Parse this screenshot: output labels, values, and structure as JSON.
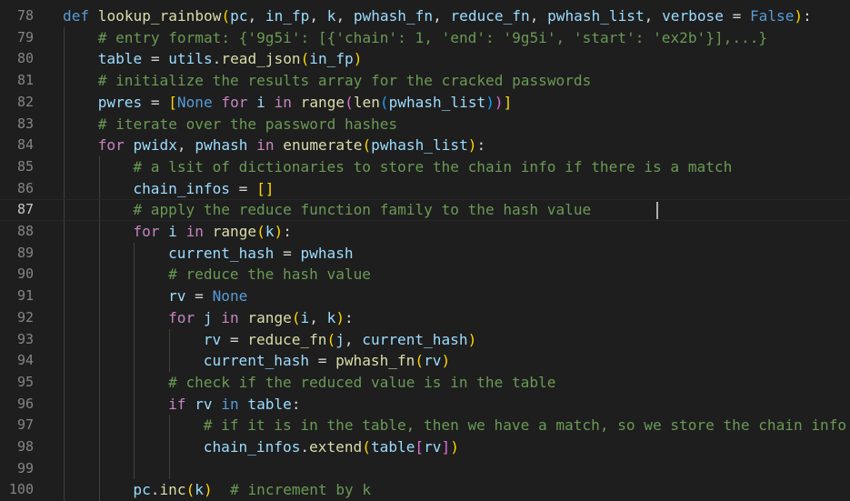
{
  "editor": {
    "cursor_line": 87,
    "lines": [
      {
        "n": "78",
        "ind": 0,
        "t": [
          [
            "kw",
            "def"
          ],
          [
            "pn",
            " "
          ],
          [
            "fn",
            "lookup_rainbow"
          ],
          [
            "br1",
            "("
          ],
          [
            "var",
            "pc"
          ],
          [
            "pn",
            ", "
          ],
          [
            "var",
            "in_fp"
          ],
          [
            "pn",
            ", "
          ],
          [
            "var",
            "k"
          ],
          [
            "pn",
            ", "
          ],
          [
            "var",
            "pwhash_fn"
          ],
          [
            "pn",
            ", "
          ],
          [
            "var",
            "reduce_fn"
          ],
          [
            "pn",
            ", "
          ],
          [
            "var",
            "pwhash_list"
          ],
          [
            "pn",
            ", "
          ],
          [
            "var",
            "verbose"
          ],
          [
            "pn",
            " = "
          ],
          [
            "kw",
            "False"
          ],
          [
            "br1",
            ")"
          ],
          [
            "pn",
            ":"
          ]
        ]
      },
      {
        "n": "79",
        "ind": 1,
        "t": [
          [
            "cm",
            "# entry format: {'9g5i': [{'chain': 1, 'end': '9g5i', 'start': 'ex2b'}],...}"
          ]
        ]
      },
      {
        "n": "80",
        "ind": 1,
        "t": [
          [
            "var",
            "table"
          ],
          [
            "pn",
            " = "
          ],
          [
            "var",
            "utils"
          ],
          [
            "pn",
            "."
          ],
          [
            "fn",
            "read_json"
          ],
          [
            "br1",
            "("
          ],
          [
            "var",
            "in_fp"
          ],
          [
            "br1",
            ")"
          ]
        ]
      },
      {
        "n": "81",
        "ind": 1,
        "t": [
          [
            "cm",
            "# initialize the results array for the cracked passwords"
          ]
        ]
      },
      {
        "n": "82",
        "ind": 1,
        "t": [
          [
            "var",
            "pwres"
          ],
          [
            "pn",
            " = "
          ],
          [
            "br1",
            "["
          ],
          [
            "kw",
            "None"
          ],
          [
            "pn",
            " "
          ],
          [
            "ctl",
            "for"
          ],
          [
            "pn",
            " "
          ],
          [
            "var",
            "i"
          ],
          [
            "pn",
            " "
          ],
          [
            "ctl",
            "in"
          ],
          [
            "pn",
            " "
          ],
          [
            "fn",
            "range"
          ],
          [
            "br2",
            "("
          ],
          [
            "fn",
            "len"
          ],
          [
            "br3",
            "("
          ],
          [
            "var",
            "pwhash_list"
          ],
          [
            "br3",
            ")"
          ],
          [
            "br2",
            ")"
          ],
          [
            "br1",
            "]"
          ]
        ]
      },
      {
        "n": "83",
        "ind": 1,
        "t": [
          [
            "cm",
            "# iterate over the password hashes"
          ]
        ]
      },
      {
        "n": "84",
        "ind": 1,
        "t": [
          [
            "ctl",
            "for"
          ],
          [
            "pn",
            " "
          ],
          [
            "var",
            "pwidx"
          ],
          [
            "pn",
            ", "
          ],
          [
            "var",
            "pwhash"
          ],
          [
            "pn",
            " "
          ],
          [
            "ctl",
            "in"
          ],
          [
            "pn",
            " "
          ],
          [
            "fn",
            "enumerate"
          ],
          [
            "br1",
            "("
          ],
          [
            "var",
            "pwhash_list"
          ],
          [
            "br1",
            ")"
          ],
          [
            "pn",
            ":"
          ]
        ]
      },
      {
        "n": "85",
        "ind": 2,
        "t": [
          [
            "cm",
            "# a lsit of dictionaries to store the chain info if there is a match"
          ]
        ]
      },
      {
        "n": "86",
        "ind": 2,
        "t": [
          [
            "var",
            "chain_infos"
          ],
          [
            "pn",
            " = "
          ],
          [
            "br1",
            "[]"
          ]
        ]
      },
      {
        "n": "87",
        "ind": 2,
        "t": [
          [
            "cm",
            "# apply the reduce function family to the hash value"
          ]
        ]
      },
      {
        "n": "88",
        "ind": 2,
        "t": [
          [
            "ctl",
            "for"
          ],
          [
            "pn",
            " "
          ],
          [
            "var",
            "i"
          ],
          [
            "pn",
            " "
          ],
          [
            "ctl",
            "in"
          ],
          [
            "pn",
            " "
          ],
          [
            "fn",
            "range"
          ],
          [
            "br1",
            "("
          ],
          [
            "var",
            "k"
          ],
          [
            "br1",
            ")"
          ],
          [
            "pn",
            ":"
          ]
        ]
      },
      {
        "n": "89",
        "ind": 3,
        "t": [
          [
            "var",
            "current_hash"
          ],
          [
            "pn",
            " = "
          ],
          [
            "var",
            "pwhash"
          ]
        ]
      },
      {
        "n": "90",
        "ind": 3,
        "t": [
          [
            "cm",
            "# reduce the hash value"
          ]
        ]
      },
      {
        "n": "91",
        "ind": 3,
        "t": [
          [
            "var",
            "rv"
          ],
          [
            "pn",
            " = "
          ],
          [
            "kw",
            "None"
          ]
        ]
      },
      {
        "n": "92",
        "ind": 3,
        "t": [
          [
            "ctl",
            "for"
          ],
          [
            "pn",
            " "
          ],
          [
            "var",
            "j"
          ],
          [
            "pn",
            " "
          ],
          [
            "ctl",
            "in"
          ],
          [
            "pn",
            " "
          ],
          [
            "fn",
            "range"
          ],
          [
            "br1",
            "("
          ],
          [
            "var",
            "i"
          ],
          [
            "pn",
            ", "
          ],
          [
            "var",
            "k"
          ],
          [
            "br1",
            ")"
          ],
          [
            "pn",
            ":"
          ]
        ]
      },
      {
        "n": "93",
        "ind": 4,
        "t": [
          [
            "var",
            "rv"
          ],
          [
            "pn",
            " = "
          ],
          [
            "fn",
            "reduce_fn"
          ],
          [
            "br1",
            "("
          ],
          [
            "var",
            "j"
          ],
          [
            "pn",
            ", "
          ],
          [
            "var",
            "current_hash"
          ],
          [
            "br1",
            ")"
          ]
        ]
      },
      {
        "n": "94",
        "ind": 4,
        "t": [
          [
            "var",
            "current_hash"
          ],
          [
            "pn",
            " = "
          ],
          [
            "fn",
            "pwhash_fn"
          ],
          [
            "br1",
            "("
          ],
          [
            "var",
            "rv"
          ],
          [
            "br1",
            ")"
          ]
        ]
      },
      {
        "n": "95",
        "ind": 3,
        "t": [
          [
            "cm",
            "# check if the reduced value is in the table"
          ]
        ]
      },
      {
        "n": "96",
        "ind": 3,
        "t": [
          [
            "ctl",
            "if"
          ],
          [
            "pn",
            " "
          ],
          [
            "var",
            "rv"
          ],
          [
            "pn",
            " "
          ],
          [
            "kw",
            "in"
          ],
          [
            "pn",
            " "
          ],
          [
            "var",
            "table"
          ],
          [
            "pn",
            ":"
          ]
        ]
      },
      {
        "n": "97",
        "ind": 4,
        "t": [
          [
            "cm",
            "# if it is in the table, then we have a match, so we store the chain info"
          ]
        ]
      },
      {
        "n": "98",
        "ind": 4,
        "t": [
          [
            "var",
            "chain_infos"
          ],
          [
            "pn",
            "."
          ],
          [
            "fn",
            "extend"
          ],
          [
            "br1",
            "("
          ],
          [
            "var",
            "table"
          ],
          [
            "br2",
            "["
          ],
          [
            "var",
            "rv"
          ],
          [
            "br2",
            "]"
          ],
          [
            "br1",
            ")"
          ]
        ]
      },
      {
        "n": "99",
        "ind": 0,
        "t": []
      },
      {
        "n": "100",
        "ind": 2,
        "t": [
          [
            "var",
            "pc"
          ],
          [
            "pn",
            "."
          ],
          [
            "fn",
            "inc"
          ],
          [
            "br1",
            "("
          ],
          [
            "var",
            "k"
          ],
          [
            "br1",
            ")"
          ],
          [
            "pn",
            "  "
          ],
          [
            "cm",
            "# increment by k"
          ]
        ]
      }
    ]
  }
}
